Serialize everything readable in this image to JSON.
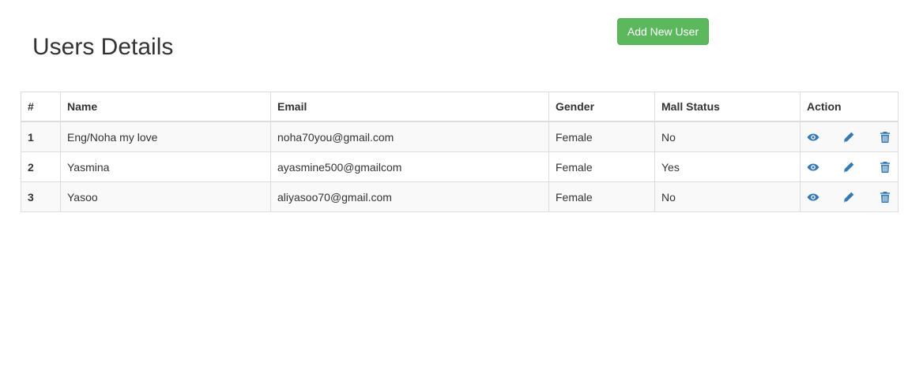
{
  "page": {
    "title": "Users Details",
    "add_button_label": "Add New User"
  },
  "colors": {
    "add_button": "#5cb85c",
    "action_icon": "#337ab7",
    "table_border": "#dddddd",
    "striped_row": "#f9f9f9"
  },
  "table": {
    "headers": [
      "#",
      "Name",
      "Email",
      "Gender",
      "Mall Status",
      "Action"
    ],
    "rows": [
      {
        "num": "1",
        "name": "Eng/Noha my love",
        "email": "noha70you@gmail.com",
        "gender": "Female",
        "mall_status": "No"
      },
      {
        "num": "2",
        "name": "Yasmina",
        "email": "ayasmine500@gmailcom",
        "gender": "Female",
        "mall_status": "Yes"
      },
      {
        "num": "3",
        "name": "Yasoo",
        "email": "aliyasoo70@gmail.com",
        "gender": "Female",
        "mall_status": "No"
      }
    ],
    "action_icons": [
      "eye-icon",
      "pencil-icon",
      "trash-icon"
    ]
  }
}
